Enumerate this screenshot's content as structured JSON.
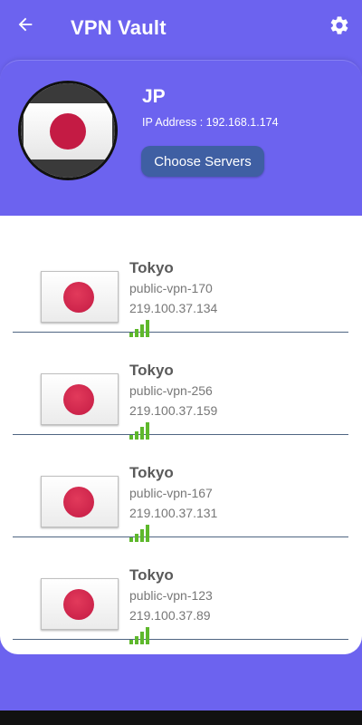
{
  "app_bar": {
    "title": "VPN Vault",
    "back_icon": "arrow-left-icon",
    "settings_icon": "gear-icon"
  },
  "current": {
    "country": "JP",
    "ip_label": "IP Address : 192.168.1.174",
    "choose_button": "Choose Servers",
    "flag_icon": "japan-flag-icon"
  },
  "servers": [
    {
      "city": "Tokyo",
      "host": "public-vpn-170",
      "ip": "219.100.37.134",
      "signal_bars": 4
    },
    {
      "city": "Tokyo",
      "host": "public-vpn-256",
      "ip": "219.100.37.159",
      "signal_bars": 4
    },
    {
      "city": "Tokyo",
      "host": "public-vpn-167",
      "ip": "219.100.37.131",
      "signal_bars": 4
    },
    {
      "city": "Tokyo",
      "host": "public-vpn-123",
      "ip": "219.100.37.89",
      "signal_bars": 4
    }
  ],
  "colors": {
    "primary": "#6c63ef",
    "button": "#3f5fa3",
    "signal": "#5eb82c",
    "flag_red": "#c41b44",
    "divider": "#4f6582"
  }
}
